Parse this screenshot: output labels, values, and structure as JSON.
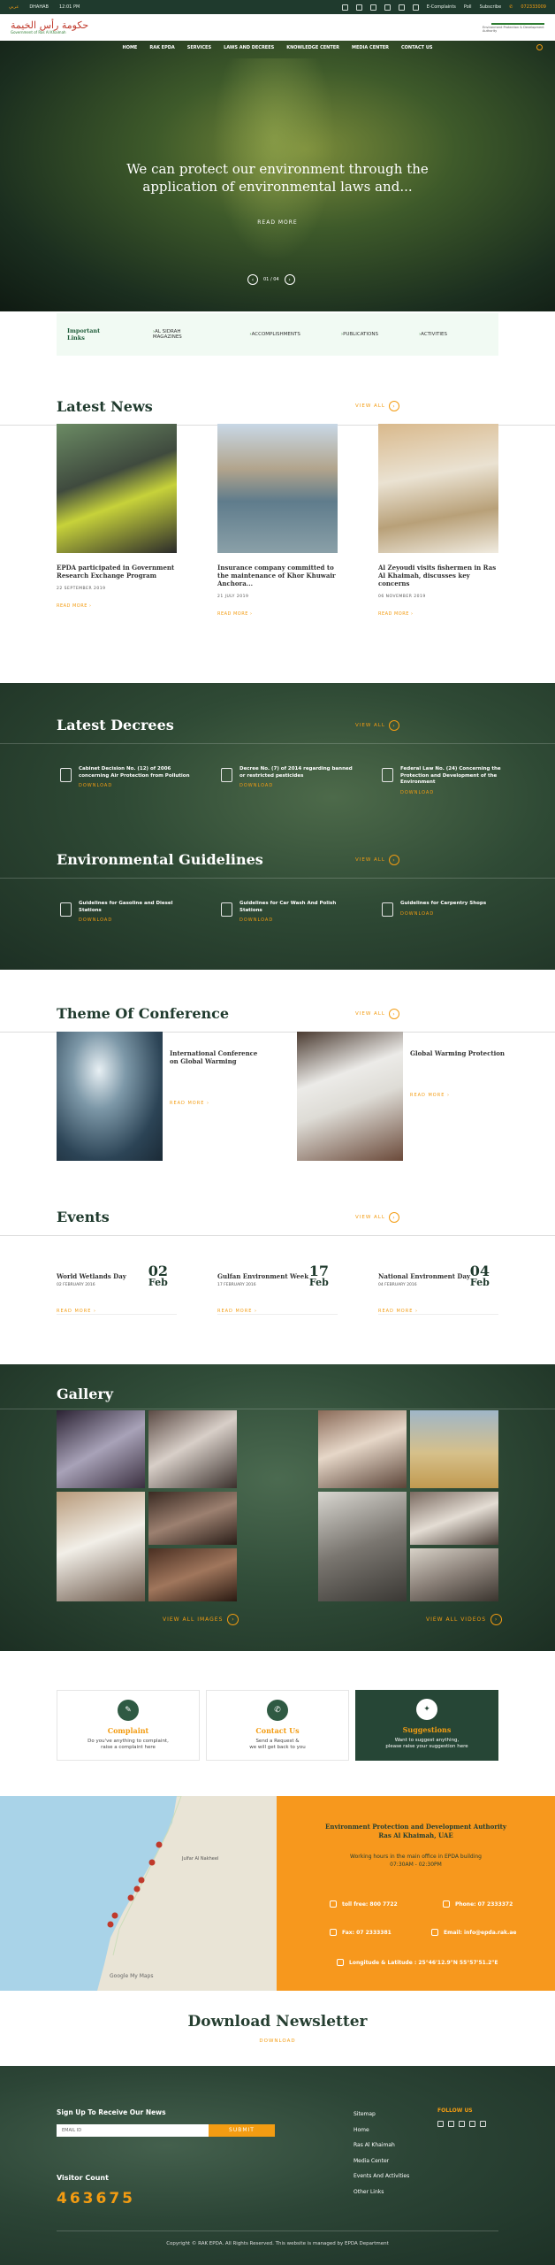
{
  "topbar": {
    "arabic": "عربي",
    "location": "DHAHAB",
    "time": "12:01 PM",
    "ecomplaints": "E-Complaints",
    "poll": "Poll",
    "subscribe": "Subscribe",
    "phone": "072333009"
  },
  "header": {
    "logo_ar": "حكومة رأس الخيمة",
    "logo_en": "Government of Ras Al Khaimah",
    "logo_right": "Environment Protection & Development Authority"
  },
  "nav": [
    "HOME",
    "RAK EPDA",
    "SERVICES",
    "LAWS AND DECREES",
    "KNOWLEDGE CENTER",
    "MEDIA CENTER",
    "CONTACT US"
  ],
  "hero": {
    "title_line1": "We can protect our environment through the",
    "title_line2": "application of environmental laws and...",
    "read_more": "READ MORE",
    "pager": "01 / 04",
    "prev": "‹",
    "next": "›"
  },
  "important_links": {
    "title": "Important Links",
    "items": [
      "AL SIDRAH MAGAZINES",
      "ACCOMPLISHMENTS",
      "PUBLICATIONS",
      "ACTIVITIES"
    ]
  },
  "latest_news": {
    "title": "Latest News",
    "view_all": "VIEW ALL",
    "items": [
      {
        "title": "EPDA participated in Government Research Exchange Program",
        "date": "22 SEPTEMBER 2019",
        "read_more": "READ MORE"
      },
      {
        "title": "Insurance company committed to the maintenance of Khor Khuwair Anchora...",
        "date": "21 JULY 2019",
        "read_more": "READ MORE"
      },
      {
        "title": "Al Zeyoudi visits fishermen in Ras Al Khaimah, discusses key concerns",
        "date": "06 NOVEMBER 2019",
        "read_more": "READ MORE"
      }
    ]
  },
  "latest_decrees": {
    "title": "Latest Decrees",
    "view_all": "VIEW ALL",
    "items": [
      {
        "title": "Cabinet Decision No. (12) of 2006 concerning Air Protection from Pollution",
        "download": "DOWNLOAD"
      },
      {
        "title": "Decree No. (7) of 2014 regarding banned or restricted pesticides",
        "download": "DOWNLOAD"
      },
      {
        "title": "Federal Law No. (24) Concerning the Protection and Development of the Environment",
        "download": "DOWNLOAD"
      }
    ]
  },
  "guidelines": {
    "title": "Environmental Guidelines",
    "view_all": "VIEW ALL",
    "items": [
      {
        "title": "Guidelines for Gasoline and Diesel Stations",
        "download": "DOWNLOAD"
      },
      {
        "title": "Guidelines for Car Wash And Polish Stations",
        "download": "DOWNLOAD"
      },
      {
        "title": "Guidelines for Carpentry Shops",
        "download": "DOWNLOAD"
      }
    ]
  },
  "conference": {
    "title": "Theme Of Conference",
    "view_all": "VIEW ALL",
    "items": [
      {
        "title": "International Conference on Global Warming",
        "read_more": "READ MORE"
      },
      {
        "title": "Global Warming Protection",
        "read_more": "READ MORE"
      }
    ]
  },
  "events": {
    "title": "Events",
    "view_all": "VIEW ALL",
    "items": [
      {
        "title": "World Wetlands Day",
        "date": "02 FEBRUARY 2016",
        "day": "02",
        "month": "Feb",
        "read_more": "READ MORE"
      },
      {
        "title": "Gulfan Environment Week",
        "date": "17 FEBRUARY 2016",
        "day": "17",
        "month": "Feb",
        "read_more": "READ MORE"
      },
      {
        "title": "National Environment Day",
        "date": "04 FEBRUARY 2016",
        "day": "04",
        "month": "Feb",
        "read_more": "READ MORE"
      }
    ]
  },
  "gallery": {
    "title": "Gallery",
    "view_images": "VIEW ALL IMAGES",
    "view_videos": "VIEW ALL VIDEOS"
  },
  "cards": [
    {
      "title": "Complaint",
      "text1": "Do you've anything to complaint,",
      "text2": "raise a complaint here"
    },
    {
      "title": "Contact Us",
      "text1": "Send a Request &",
      "text2": "we will get back to you"
    },
    {
      "title": "Suggestions",
      "text1": "Want to suggest anything,",
      "text2": "please raise your suggestion here"
    }
  ],
  "contact": {
    "authority_line1": "Environment Protection and Development Authority",
    "authority_line2": "Ras Al Khaimah, UAE",
    "hours_line1": "Working hours in the main office in EPDA building",
    "hours_line2": "07:30AM - 02:30PM",
    "tollfree": "toll free: 800 7722",
    "phone": "Phone: 07 2333372",
    "fax": "Fax: 07 2333381",
    "email": "Email: info@epda.rak.ae",
    "latlng": "Longitude & Latitude : 25°46'12.9\"N 55°57'51.2\"E"
  },
  "map": {
    "label_city": "Julfar Al Nakheel",
    "label_google": "Google My Maps"
  },
  "newsletter": {
    "title": "Download Newsletter",
    "download": "DOWNLOAD"
  },
  "footer": {
    "signup": "Sign Up To Receive Our News",
    "email_placeholder": "EMAIL ID",
    "submit": "SUBMIT",
    "visitor_label": "Visitor Count",
    "visitor_count": "463675",
    "links": [
      "Sitemap",
      "Home",
      "Ras Al Khaimah",
      "Media Center",
      "Events And Activities",
      "Other Links"
    ],
    "follow": "FOLLOW US",
    "copyright": "Copyright © RAK EPDA. All Rights Reserved. This website is managed by EPDA Department"
  }
}
